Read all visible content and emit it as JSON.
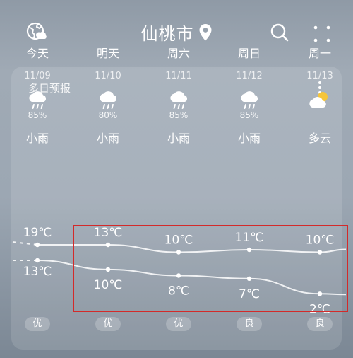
{
  "header": {
    "city": "仙桃市"
  },
  "card": {
    "title": "多日预报"
  },
  "days": [
    {
      "name": "今天",
      "date": "11/09",
      "pop": "85%",
      "cond": "小雨",
      "icon": "rain-cloud-icon",
      "high": 19,
      "low": 13,
      "high_label": "19℃",
      "low_label": "13℃",
      "aqi": "优"
    },
    {
      "name": "明天",
      "date": "11/10",
      "pop": "80%",
      "cond": "小雨",
      "icon": "rain-cloud-icon",
      "high": 13,
      "low": 10,
      "high_label": "13℃",
      "low_label": "10℃",
      "aqi": "优"
    },
    {
      "name": "周六",
      "date": "11/11",
      "pop": "85%",
      "cond": "小雨",
      "icon": "rain-cloud-icon",
      "high": 10,
      "low": 8,
      "high_label": "10℃",
      "low_label": "8℃",
      "aqi": "优"
    },
    {
      "name": "周日",
      "date": "11/12",
      "pop": "85%",
      "cond": "小雨",
      "icon": "rain-cloud-icon",
      "high": 11,
      "low": 7,
      "high_label": "11℃",
      "low_label": "7℃",
      "aqi": "良"
    },
    {
      "name": "周一",
      "date": "11/13",
      "pop": "",
      "cond": "多云",
      "icon": "partly-cloudy-icon",
      "high": 10,
      "low": 2,
      "high_label": "10℃",
      "low_label": "2℃",
      "aqi": "良"
    }
  ],
  "colors": {
    "highlight_box": "#d32a2a"
  }
}
